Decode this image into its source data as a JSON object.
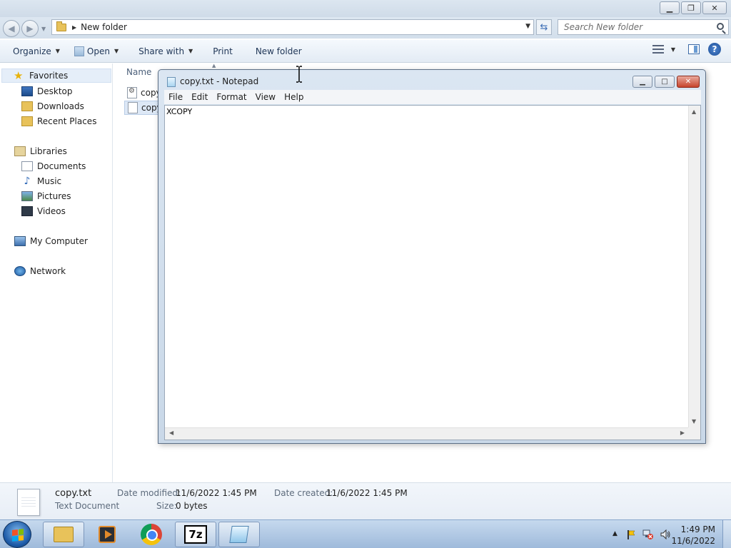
{
  "explorer": {
    "caption_buttons": {
      "minimize": "▁",
      "restore": "❐",
      "close": "✕"
    },
    "address": {
      "breadcrumb": "New folder"
    },
    "search": {
      "placeholder": "Search New folder"
    },
    "toolbar": {
      "organize": "Organize",
      "open": "Open",
      "share_with": "Share with",
      "print": "Print",
      "new_folder": "New folder",
      "help": "?"
    },
    "nav": {
      "favorites": "Favorites",
      "desktop": "Desktop",
      "downloads": "Downloads",
      "recent_places": "Recent Places",
      "libraries": "Libraries",
      "documents": "Documents",
      "music": "Music",
      "pictures": "Pictures",
      "videos": "Videos",
      "my_computer": "My Computer",
      "network": "Network"
    },
    "column_name": "Name",
    "files": [
      {
        "name": "copy"
      },
      {
        "name": "copy"
      }
    ],
    "details": {
      "file_name": "copy.txt",
      "file_type": "Text Document",
      "date_modified_label": "Date modified:",
      "date_modified": "11/6/2022 1:45 PM",
      "date_created_label": "Date created:",
      "date_created": "11/6/2022 1:45 PM",
      "size_label": "Size:",
      "size": "0 bytes"
    }
  },
  "notepad": {
    "title": "copy.txt - Notepad",
    "menu": [
      "File",
      "Edit",
      "Format",
      "View",
      "Help"
    ],
    "content": "XCOPY"
  },
  "taskbar": {
    "apps": [
      "windows-explorer",
      "media-player",
      "google-chrome",
      "7-zip",
      "notepad"
    ],
    "active_app": "notepad",
    "clock": {
      "time": "1:49 PM",
      "date": "11/6/2022"
    }
  },
  "colors": {
    "taskbar": "#b3cbe6",
    "notepad_close": "#c7432c",
    "selection": "#dde8f6"
  }
}
